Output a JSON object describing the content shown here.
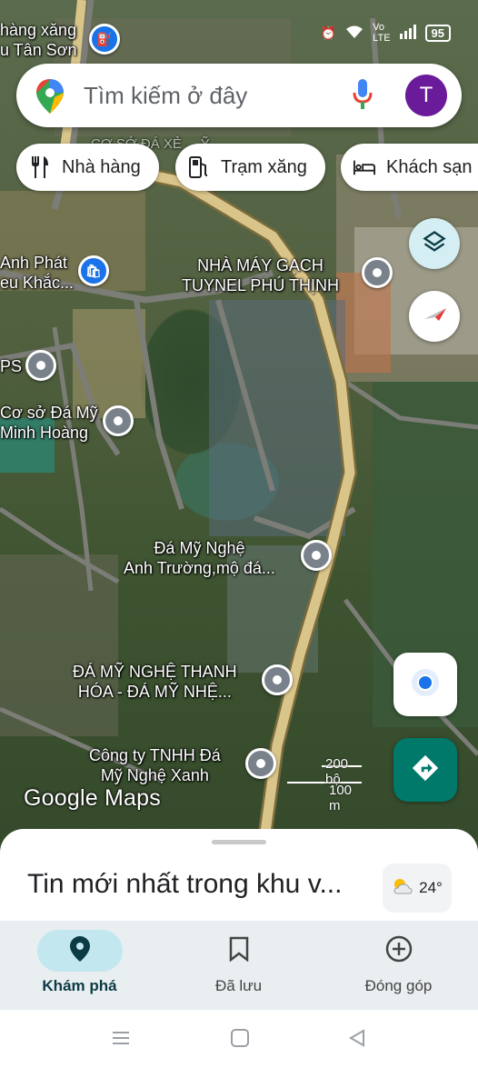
{
  "status_bar": {
    "battery": "95",
    "icons": [
      "alarm-icon",
      "wifi-icon",
      "volte-icon",
      "signal-icon"
    ]
  },
  "search": {
    "placeholder": "Tìm kiếm ở đây",
    "avatar_letter": "T"
  },
  "chips": [
    {
      "label": "Nhà hàng",
      "icon": "restaurant-icon"
    },
    {
      "label": "Trạm xăng",
      "icon": "gas-station-icon"
    },
    {
      "label": "Khách sạn",
      "icon": "hotel-icon"
    }
  ],
  "map": {
    "places": [
      {
        "label": "hàng xăng\nu Tân Sơn"
      },
      {
        "label": "Anh Phát\neu Khắc..."
      },
      {
        "label": "NHÀ MÁY GẠCH\nTUYNEL PHÚ THỊNH"
      },
      {
        "label": "PS"
      },
      {
        "label": "Cơ sở Đá Mỹ\nMinh Hoàng"
      },
      {
        "label": "Đá Mỹ Nghệ\nAnh Trường,mộ đá..."
      },
      {
        "label": "ĐÁ MỸ NGHỆ THANH\nHÓA - ĐÁ MỸ NHỆ..."
      },
      {
        "label": "Công ty TNHH Đá\nMỹ Nghệ Xanh"
      }
    ],
    "faded_label": "CƠ SỞ ĐÁ XẺ ... Ỹ",
    "scale": {
      "top": "200 bộ",
      "bottom": "100 m"
    },
    "watermark": "Google Maps"
  },
  "sheet": {
    "title": "Tin mới nhất trong khu v...",
    "temperature": "24°"
  },
  "nav": [
    {
      "label": "Khám phá",
      "icon": "explore-pin-icon",
      "active": true
    },
    {
      "label": "Đã lưu",
      "icon": "bookmark-icon",
      "active": false
    },
    {
      "label": "Đóng góp",
      "icon": "add-circle-icon",
      "active": false
    }
  ],
  "colors": {
    "accent": "#1a73e8",
    "directions": "#00796b",
    "avatar": "#6a1b9a",
    "nav_active": "#c2e7ef",
    "road": "#d9c58a"
  }
}
